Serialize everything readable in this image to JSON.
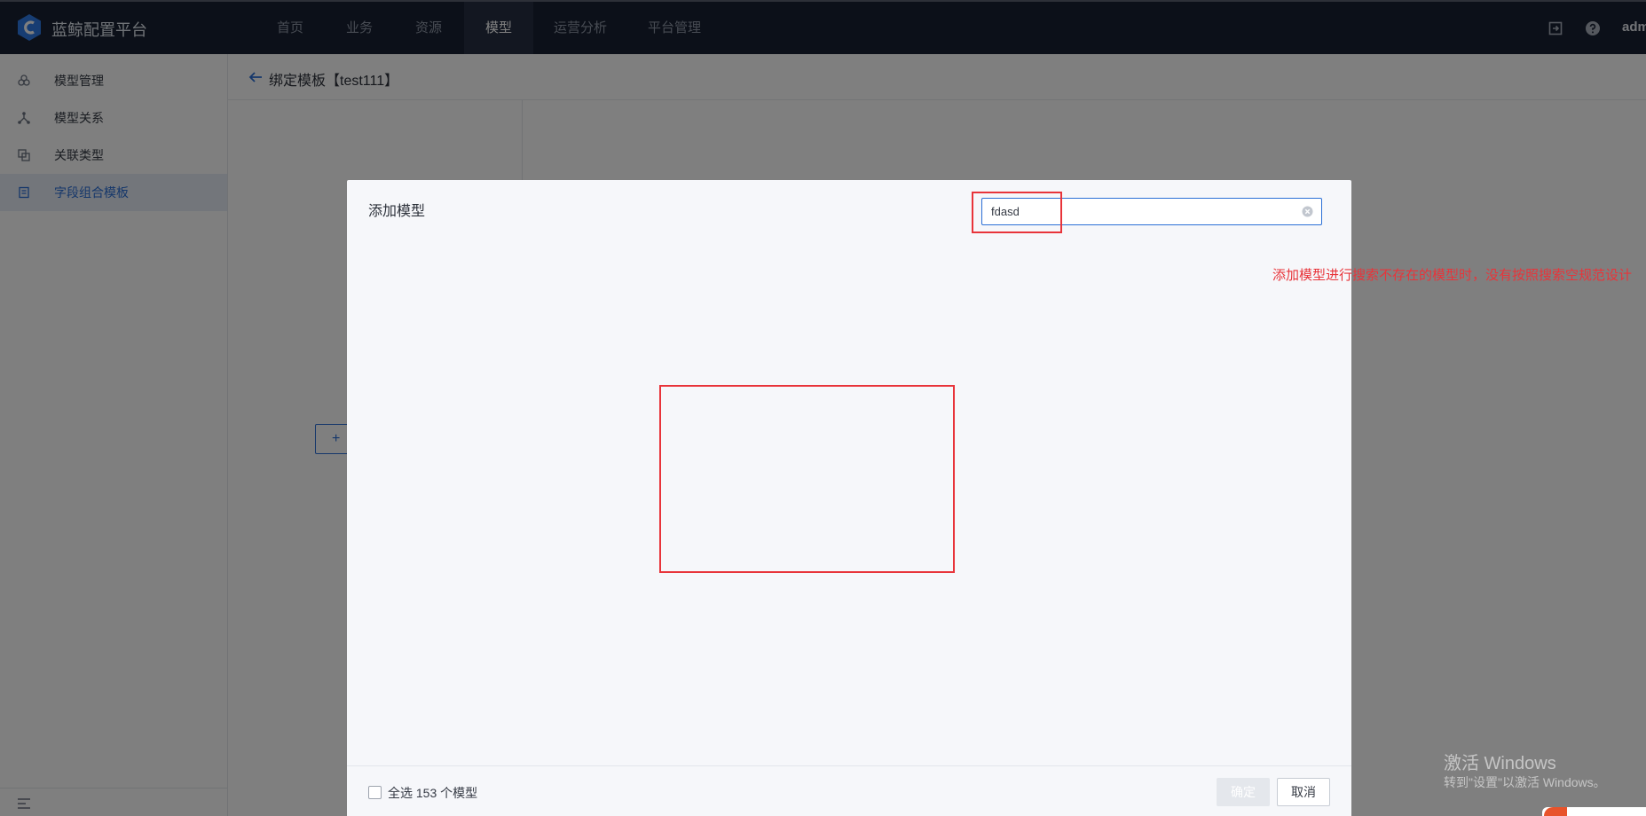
{
  "app": {
    "brand": "蓝鲸配置平台",
    "nav": [
      {
        "label": "首页",
        "active": false
      },
      {
        "label": "业务",
        "active": false
      },
      {
        "label": "资源",
        "active": false
      },
      {
        "label": "模型",
        "active": true
      },
      {
        "label": "运营分析",
        "active": false
      },
      {
        "label": "平台管理",
        "active": false
      }
    ],
    "user": "adm"
  },
  "sidebar": {
    "items": [
      {
        "label": "模型管理",
        "icon": "model-manage-icon",
        "active": false
      },
      {
        "label": "模型关系",
        "icon": "model-relation-icon",
        "active": false
      },
      {
        "label": "关联类型",
        "icon": "relation-type-icon",
        "active": false
      },
      {
        "label": "字段组合模板",
        "icon": "field-template-icon",
        "active": true
      }
    ]
  },
  "header": {
    "title": "绑定模板【test111】"
  },
  "background": {
    "add_button": "+"
  },
  "modal": {
    "title": "添加模型",
    "search_value": "fdasd",
    "select_all_label": "全选 153 个模型",
    "confirm_label": "确定",
    "cancel_label": "取消"
  },
  "annotation": {
    "text": "添加模型进行搜索不存在的模型时，没有按照搜索空规范设计"
  },
  "watermark": {
    "title": "激活 Windows",
    "subtitle": "转到\"设置\"以激活 Windows。"
  },
  "colors": {
    "accent": "#2b6fd6",
    "annotation": "#e8343a",
    "topbar": "#182132"
  }
}
